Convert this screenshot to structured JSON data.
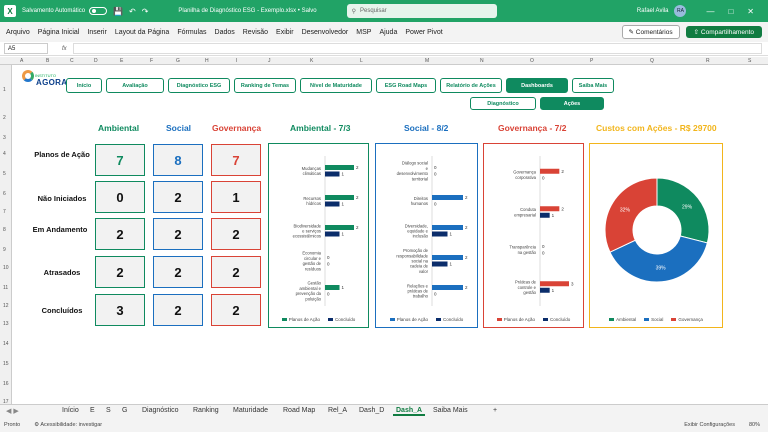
{
  "titlebar": {
    "autosave": "Salvamento Automático",
    "document": "Planilha de Diagnóstico ESG - Exemplo.xlsx • Salvo",
    "search_placeholder": "Pesquisar",
    "user": "Rafael Avila",
    "user_initials": "RA"
  },
  "menu": [
    "Arquivo",
    "Página Inicial",
    "Inserir",
    "Layout da Página",
    "Fórmulas",
    "Dados",
    "Revisão",
    "Exibir",
    "Desenvolvedor",
    "MSP",
    "Ajuda",
    "Power Pivot"
  ],
  "comments_label": "Comentários",
  "share_label": "Compartilhamento",
  "name_box": "A5",
  "fx": "fx",
  "columns": [
    "A",
    "B",
    "C",
    "D",
    "E",
    "F",
    "G",
    "H",
    "I",
    "J",
    "K",
    "L",
    "M",
    "N",
    "O",
    "P",
    "Q",
    "R",
    "S"
  ],
  "rows": [
    "1",
    "2",
    "3",
    "4",
    "5",
    "6",
    "7",
    "8",
    "9",
    "10",
    "11",
    "12",
    "13",
    "14",
    "15",
    "16",
    "17"
  ],
  "brand": {
    "top": "INSTITUTO",
    "name": "AGORA"
  },
  "nav": [
    {
      "label": "Início",
      "active": false
    },
    {
      "label": "Avaliação",
      "active": false
    },
    {
      "label": "Diagnóstico ESG",
      "active": false
    },
    {
      "label": "Ranking de Temas",
      "active": false
    },
    {
      "label": "Nível de Maturidade",
      "active": false
    },
    {
      "label": "ESG Road Maps",
      "active": false
    },
    {
      "label": "Relatório de Ações",
      "active": false
    },
    {
      "label": "Dashboards",
      "active": true
    },
    {
      "label": "Saiba Mais",
      "active": false
    }
  ],
  "subnav": [
    {
      "label": "Diagnóstico",
      "active": false
    },
    {
      "label": "Ações",
      "active": true
    }
  ],
  "headers": {
    "ambiental": "Ambiental",
    "social": "Social",
    "governanca": "Governança",
    "chart_amb": "Ambiental - 7/3",
    "chart_soc": "Social - 8/2",
    "chart_gov": "Governança - 7/2",
    "chart_cost": "Custos com Ações - R$ 29700"
  },
  "colors": {
    "ambiental": "#0f8a5f",
    "social": "#1b6fbf",
    "governanca": "#d94336",
    "navy": "#0b2d6b",
    "cost": "#f2b51c"
  },
  "summary": [
    {
      "label": "Planos de Ação",
      "values": [
        "7",
        "8",
        "7"
      ]
    },
    {
      "label": "Não Iniciados",
      "values": [
        "0",
        "2",
        "1"
      ]
    },
    {
      "label": "Em Andamento",
      "values": [
        "2",
        "2",
        "2"
      ]
    },
    {
      "label": "Atrasados",
      "values": [
        "2",
        "2",
        "2"
      ]
    },
    {
      "label": "Concluídos",
      "values": [
        "3",
        "2",
        "2"
      ]
    }
  ],
  "legend": {
    "planos": "Planos de Ação",
    "concluido": "Concluído",
    "ambiental": "Ambiental",
    "social": "Social",
    "governanca": "Governança"
  },
  "chart_data": [
    {
      "type": "bar",
      "orientation": "horizontal",
      "title": "Ambiental - 7/3",
      "categories": [
        "Mudanças climáticas",
        "Recursos hídricos",
        "Biodiversidade e serviços ecossistêmicos",
        "Economia circular e gestão de resíduos",
        "Gestão ambiental e prevenção da poluição"
      ],
      "series": [
        {
          "name": "Planos de Ação",
          "values": [
            2,
            2,
            2,
            0,
            1
          ]
        },
        {
          "name": "Concluído",
          "values": [
            1,
            1,
            1,
            0,
            0
          ]
        }
      ],
      "xlim": [
        0,
        2
      ]
    },
    {
      "type": "bar",
      "orientation": "horizontal",
      "title": "Social - 8/2",
      "categories": [
        "Diálogo social e desenvolvimento territorial",
        "Direitos humanos",
        "Diversidade, equidade e inclusão",
        "Promoção de responsabilidade social na cadeia de valor",
        "Relações e práticas de trabalho"
      ],
      "series": [
        {
          "name": "Planos de Ação",
          "values": [
            0,
            2,
            2,
            2,
            2
          ]
        },
        {
          "name": "Concluído",
          "values": [
            0,
            0,
            1,
            1,
            0
          ]
        }
      ],
      "xlim": [
        0,
        2
      ]
    },
    {
      "type": "bar",
      "orientation": "horizontal",
      "title": "Governança - 7/2",
      "categories": [
        "Governança corporativa",
        "Conduta empresarial",
        "Transparência na gestão",
        "Práticas de controle e gestão"
      ],
      "series": [
        {
          "name": "Planos de Ação",
          "values": [
            2,
            2,
            0,
            3
          ]
        },
        {
          "name": "Concluído",
          "values": [
            0,
            1,
            0,
            1
          ]
        }
      ],
      "xlim": [
        0,
        3
      ]
    },
    {
      "type": "pie",
      "donut": true,
      "title": "Custos com Ações - R$ 29700",
      "categories": [
        "Ambiental",
        "Social",
        "Governança"
      ],
      "values": [
        29,
        39,
        32
      ],
      "labels": [
        "29%",
        "39%",
        "32%"
      ]
    }
  ],
  "sheet_tabs": [
    "Início",
    "E",
    "S",
    "G",
    "Diagnóstico",
    "Ranking",
    "Maturidade",
    "Road Map",
    "Rel_A",
    "Dash_D",
    "Dash_A",
    "Saiba Mais",
    "+"
  ],
  "active_tab": "Dash_A",
  "status": {
    "ready": "Pronto",
    "accessibility": "Acessibilidade: investigar",
    "display": "Exibir Configurações",
    "zoom": "80%"
  }
}
